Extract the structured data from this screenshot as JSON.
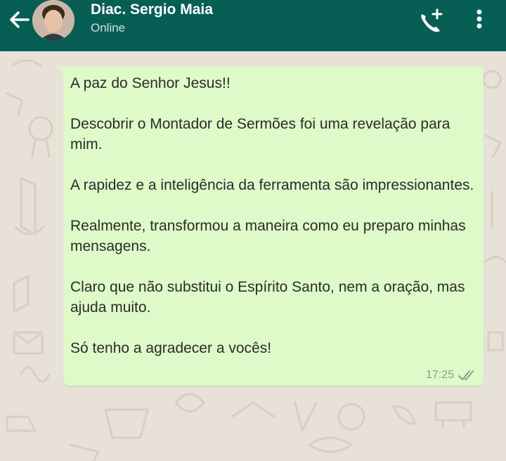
{
  "header": {
    "contact_name": "Diac. Sergio Maia",
    "status": "Online",
    "icons": {
      "back": "arrow-left-icon",
      "call": "add-call-icon",
      "menu": "more-vert-icon"
    },
    "colors": {
      "bar": "#075e55",
      "text": "#ffffff"
    }
  },
  "message": {
    "paragraphs": [
      "A paz do Senhor Jesus!!",
      "Descobrir o Montador de Sermões foi uma revelação para mim.",
      "A rapidez e a inteligência da ferramenta são impressionantes.",
      "Realmente, transformou a maneira como eu preparo minhas mensagens.",
      "Claro que não substitui o Espírito Santo, nem a oração, mas ajuda muito.",
      "Só tenho a agradecer a vocês!"
    ],
    "time": "17:25",
    "status_icon": "double-check-icon",
    "bubble_color": "#ddfac8"
  },
  "chat": {
    "background_color": "#e8e1d8"
  }
}
